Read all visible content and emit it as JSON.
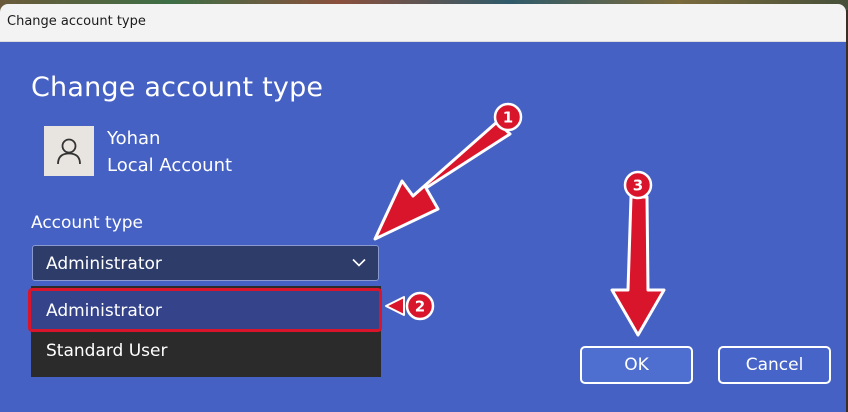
{
  "window": {
    "title": "Change account type"
  },
  "dialog": {
    "heading": "Change account type",
    "user": {
      "name": "Yohan",
      "account_kind": "Local Account",
      "avatar_icon": "person-icon"
    },
    "account_type": {
      "label": "Account type",
      "selected": "Administrator",
      "options": [
        "Administrator",
        "Standard User"
      ]
    },
    "buttons": {
      "ok": "OK",
      "cancel": "Cancel"
    }
  },
  "annotations": {
    "badges": [
      "1",
      "2",
      "3"
    ],
    "color": "#d8152b"
  },
  "colors": {
    "dialog_bg": "#4561c4",
    "titlebar_bg": "#f3f3f3",
    "dropdown_bg": "#2e3c6a",
    "list_bg": "#2b2b2b",
    "highlight_border": "#d8152b"
  }
}
